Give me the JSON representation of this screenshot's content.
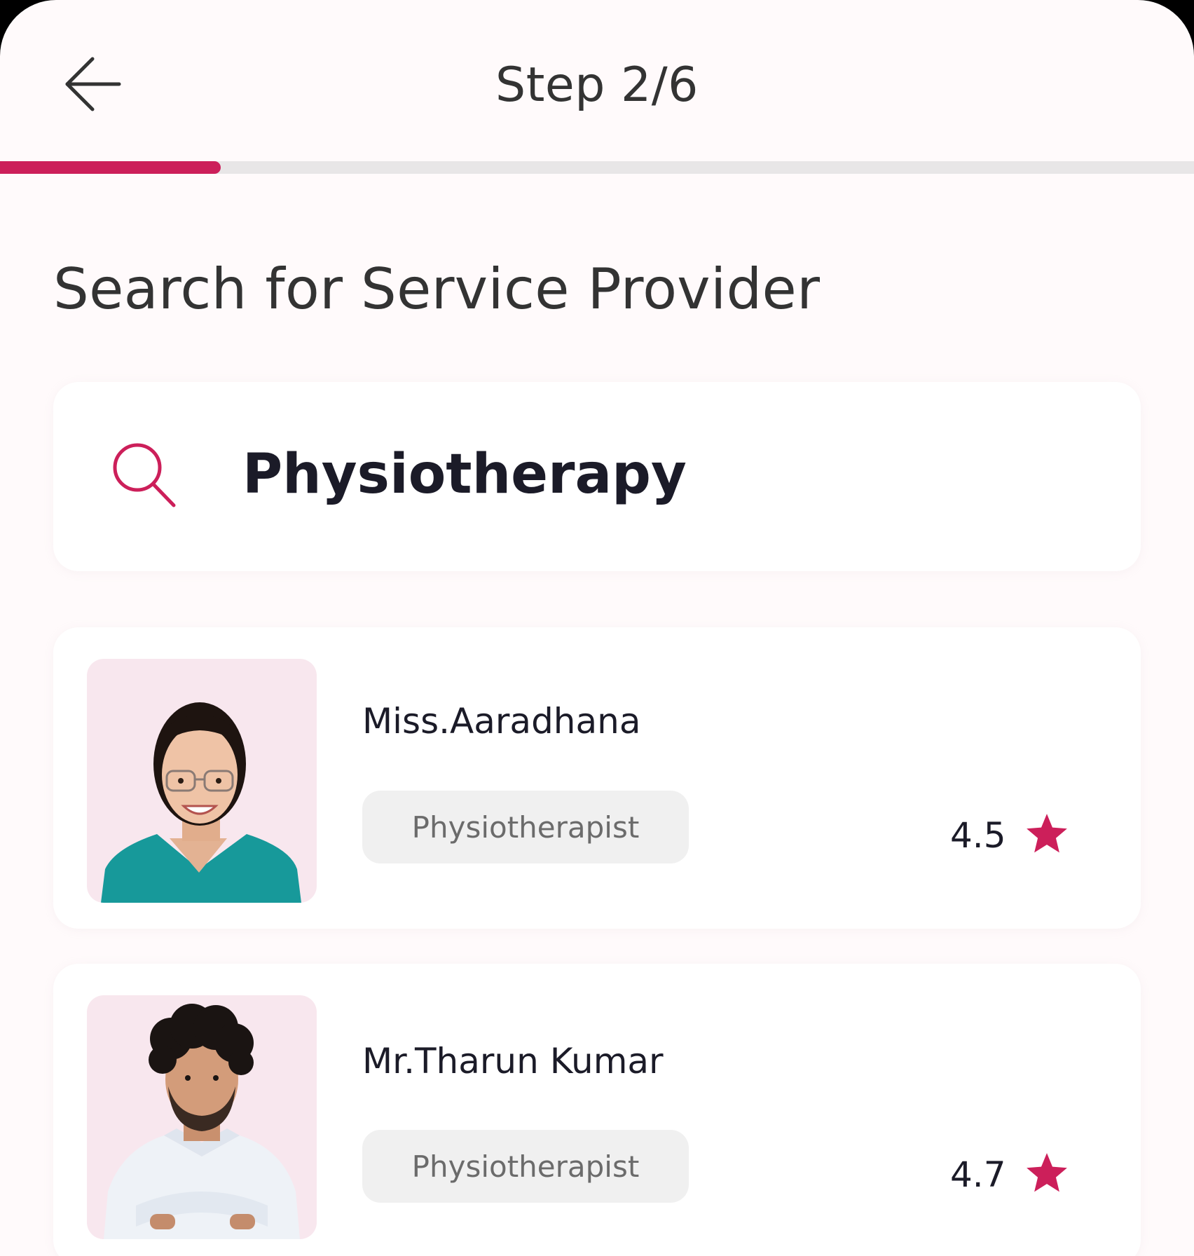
{
  "header": {
    "step_label": "Step 2/6",
    "progress_fraction": 0.185
  },
  "page": {
    "title": "Search for Service Provider"
  },
  "search": {
    "value": "Physiotherapy",
    "icon": "search-icon"
  },
  "providers": [
    {
      "name": "Miss.Aaradhana",
      "role": "Physiotherapist",
      "rating": "4.5",
      "avatar": "woman in teal scrubs with glasses"
    },
    {
      "name": "Mr.Tharun Kumar",
      "role": "Physiotherapist",
      "rating": "4.7",
      "avatar": "man with curly hair in white coat"
    }
  ],
  "colors": {
    "accent": "#cc1f5a",
    "background": "#fffafb",
    "avatar_bg": "#f8e7ee",
    "chip_bg": "#f0f0f0"
  }
}
